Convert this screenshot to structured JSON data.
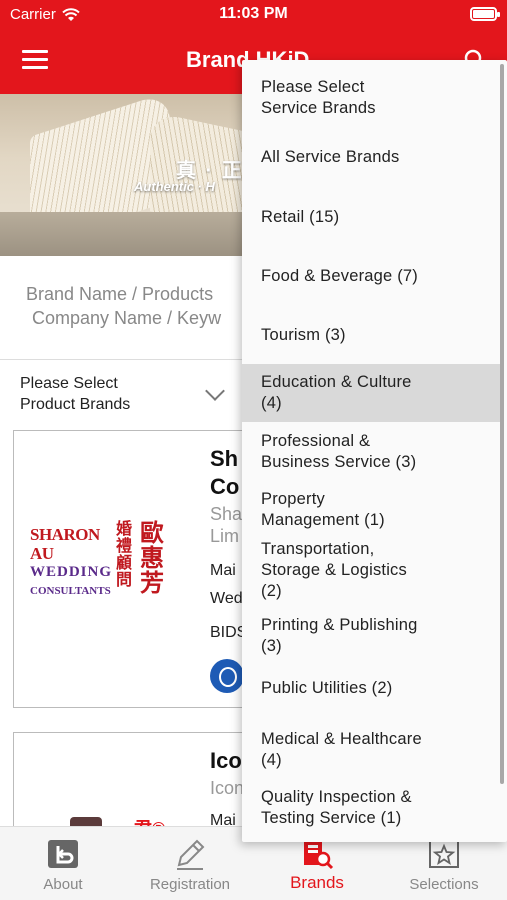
{
  "status_bar": {
    "carrier": "Carrier",
    "time": "11:03 PM"
  },
  "nav": {
    "title": "Brand HKiD"
  },
  "banner": {
    "chinese_text": "真 · 正",
    "english_text": "Authentic · H"
  },
  "search": {
    "line1": "Brand Name / Products",
    "line2": "Company Name / Keyw"
  },
  "filter": {
    "product_brands": "Please Select\nProduct Brands"
  },
  "cards": [
    {
      "title": "Sh\nCo",
      "subtitle": "Sha\nLim",
      "line1": "Mai",
      "line2": "Wed",
      "line3": "BIDS",
      "logo_en_1": "SHARON AU",
      "logo_en_2": "WEDDING",
      "logo_en_3": "CONSULTANTS",
      "logo_cn_1": "婚禮顧問",
      "logo_cn_2": "歐惠芳"
    },
    {
      "title": "Ico",
      "subtitle": "Icon",
      "line1": "Mai",
      "logo_mark": "君®"
    }
  ],
  "tabs": [
    {
      "label": "About",
      "icon": "about-icon"
    },
    {
      "label": "Registration",
      "icon": "pencil-icon"
    },
    {
      "label": "Brands",
      "icon": "brands-icon"
    },
    {
      "label": "Selections",
      "icon": "star-icon"
    }
  ],
  "dropdown": {
    "items": [
      "Please Select\nService Brands",
      "All Service Brands",
      "Retail (15)",
      "Food & Beverage (7)",
      "Tourism (3)",
      "Education & Culture\n(4)",
      "Professional &\nBusiness Service (3)",
      "Property\nManagement (1)",
      "Transportation,\nStorage & Logistics\n(2)",
      "Printing & Publishing\n(3)",
      "Public Utilities (2)",
      "Medical & Healthcare\n(4)",
      "Quality Inspection &\nTesting Service (1)"
    ],
    "selected_index": 5
  },
  "colors": {
    "brand_red": "#e3161c",
    "selected_bg": "#d9d9d9"
  }
}
